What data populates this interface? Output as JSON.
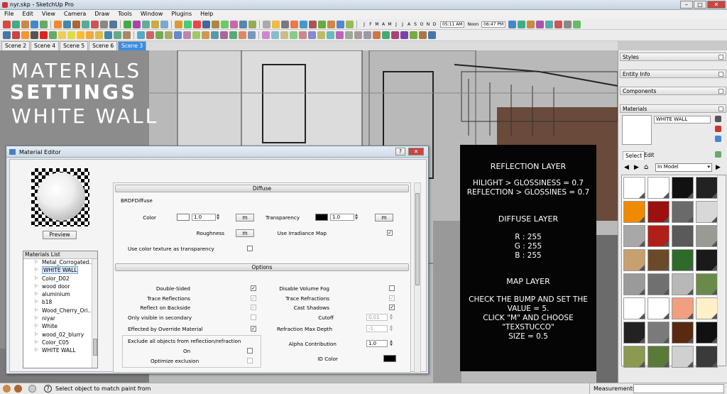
{
  "window": {
    "title": "nyr.skp - SketchUp Pro"
  },
  "menu": [
    "File",
    "Edit",
    "View",
    "Camera",
    "Draw",
    "Tools",
    "Window",
    "Plugins",
    "Help"
  ],
  "shadow_toolbar": {
    "months": [
      "J",
      "F",
      "M",
      "A",
      "M",
      "J",
      "J",
      "A",
      "S",
      "O",
      "N",
      "D"
    ],
    "time_start": "05:11 AM",
    "noon_label": "Noon",
    "time_end": "06:47 PM"
  },
  "scene_tabs": [
    "Scene 2",
    "Scene 4",
    "Scene 5",
    "Scene 6",
    "Scene 3"
  ],
  "active_scene": "Scene 3",
  "overlay_title": {
    "line1": "MATERIALS",
    "line2": "SETTINGS",
    "line3": "WHITE WALL"
  },
  "material_editor": {
    "title": "Material Editor",
    "help_label": "?",
    "preview_label": "Preview",
    "materials_list_header": "Materials List",
    "materials": [
      "Metal_Corrogated...",
      "WHITE WALL",
      "Color_D02",
      "wood door",
      "aluminium",
      "b18",
      "Wood_Cherry_Ori...",
      "niyar",
      "White",
      "wood_02_blurry",
      "Color_C05",
      "WHITE WALL"
    ],
    "selected_index": 1,
    "diffuse": {
      "header": "Diffuse",
      "brdf": "BRDFDiffuse",
      "color_label": "Color",
      "color_value": "1.0",
      "color_map": "m",
      "transparency_label": "Transparency",
      "transparency_value": "1.0",
      "transparency_map": "m",
      "roughness_label": "Roughness",
      "roughness_map": "m",
      "irradiance_label": "Use Irradiance Map",
      "texture_transparency_label": "Use color texture as transparency"
    },
    "options": {
      "header": "Options",
      "double_sided": "Double-Sided",
      "trace_reflections": "Trace Reflections",
      "reflect_backside": "Reflect on Backside",
      "only_secondary": "Only visible in secondary",
      "override_material": "Effected by Override Material",
      "exclude_objects": "Exclude all objects from reflection/refraction",
      "on_label": "On",
      "optimize_exclusion": "Optimize exclusion",
      "disable_fog": "Disable Volume Fog",
      "trace_refractions": "Trace Refractions",
      "cast_shadows": "Cast Shadows",
      "cutoff_label": "Cutoff",
      "cutoff_value": "0.01",
      "refraction_depth_label": "Refraction Max Depth",
      "refraction_depth_value": "-1",
      "alpha_label": "Alpha Contribution",
      "alpha_value": "1.0",
      "id_color_label": "ID Color"
    }
  },
  "info_panel": {
    "reflection_title": "REFLECTION LAYER",
    "reflection_line1": "HILIGHT > GLOSSINESS = 0.7",
    "reflection_line2": "REFLECTION > GLOSSINES = 0.7",
    "diffuse_title": "DIFFUSE LAYER",
    "r": "R : 255",
    "g": "G : 255",
    "b": "B : 255",
    "map_title": "MAP LAYER",
    "map_line1": "CHECK THE BUMP AND SET THE",
    "map_line2": "VALUE = 5.",
    "map_line3": "CLICK \"M\" AND CHOOSE",
    "map_line4": "\"TEXSTUCCO\"",
    "map_line5": "SIZE = 0.5"
  },
  "tray": {
    "styles": "Styles",
    "entity_info": "Entity Info",
    "components": "Components",
    "materials": "Materials",
    "material_name": "WHITE WALL",
    "tab_select": "Select",
    "tab_edit": "Edit",
    "collection": "In Model",
    "swatch_colors": [
      "#ffffff",
      "#ffffff",
      "#111111",
      "#222222",
      "#f08a00",
      "#9c1010",
      "#6a6a6a",
      "#d8d8d8",
      "#a8a8a8",
      "#b02018",
      "#5a5a5a",
      "#9a9a94",
      "#c8a070",
      "#6b4a2a",
      "#2e6a2a",
      "#1a1a1a",
      "#9a9a9a",
      "#707070",
      "#b8b8b8",
      "#6a8a4a",
      "#ffffff",
      "#ffffff",
      "#f0a080",
      "#fff0c8",
      "#222222",
      "#7a7a7a",
      "#5a2a10",
      "#111111",
      "#8a9a50",
      "#5a7a3a",
      "#d0d0d0",
      "#3a3a3a"
    ]
  },
  "status": {
    "hint": "Select object to match paint from",
    "measurements": "Measurements"
  },
  "colors": {
    "accent": "#3c8de0",
    "info_bg": "#050505"
  }
}
